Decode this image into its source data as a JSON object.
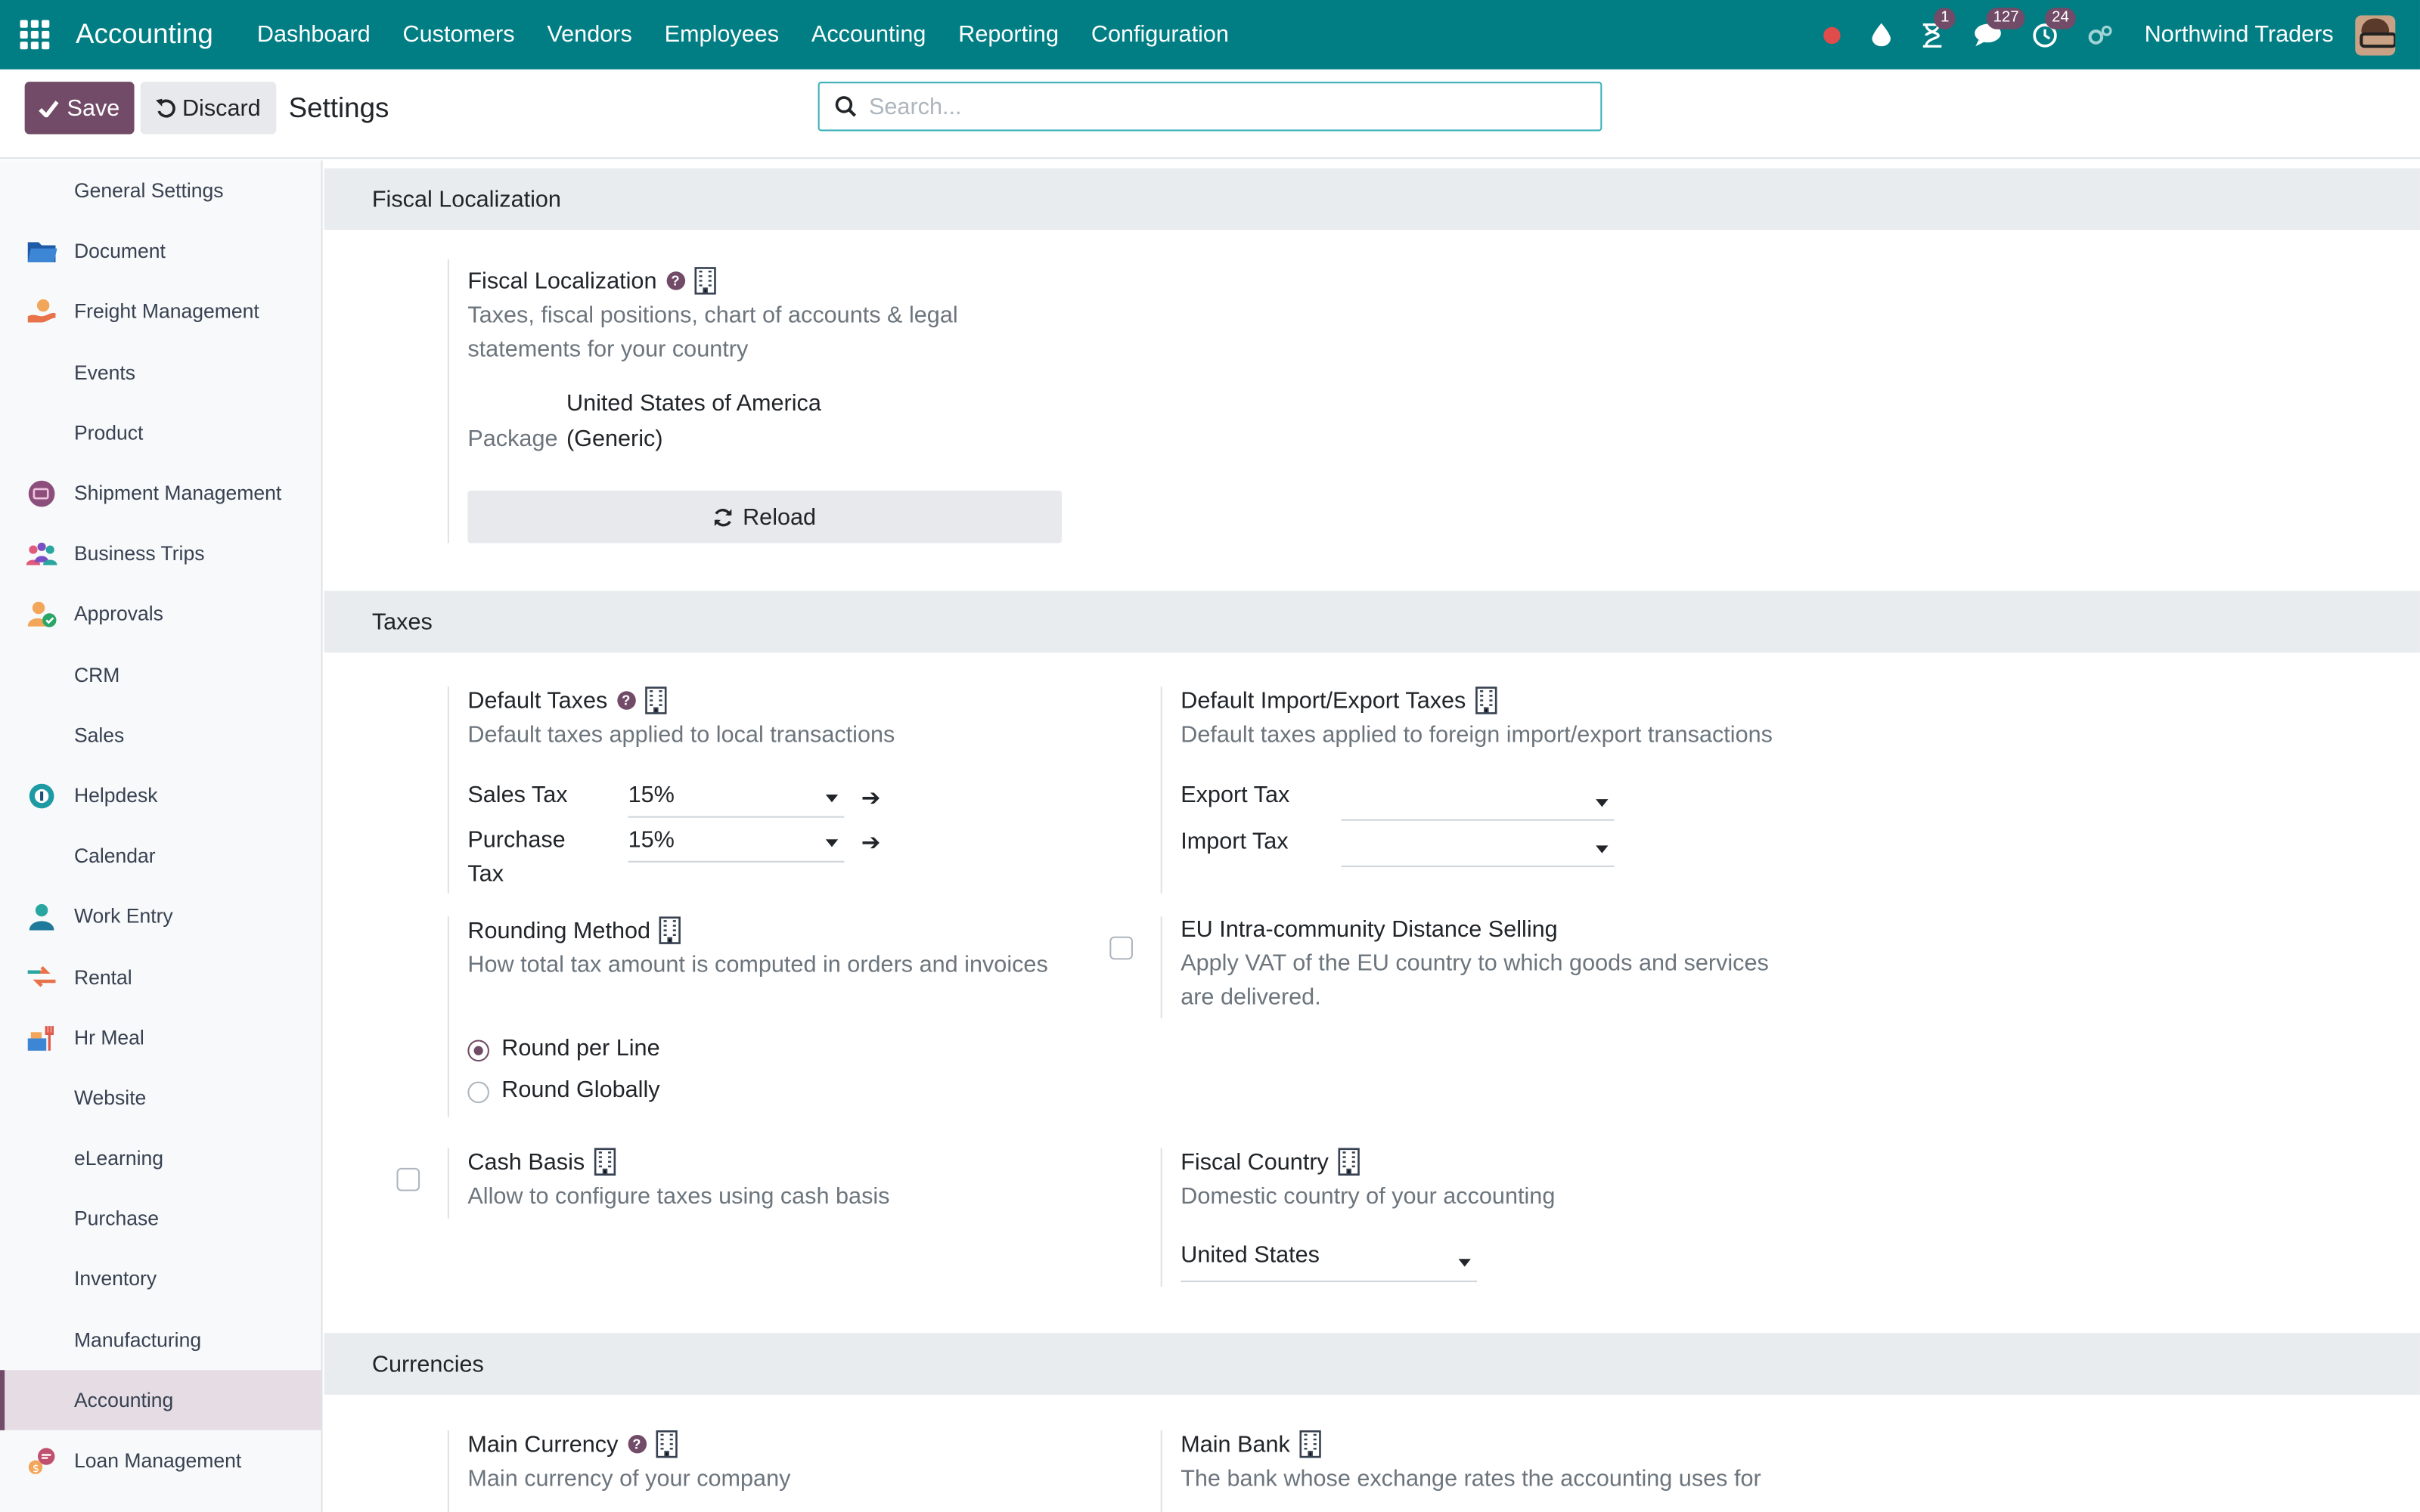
{
  "navbar": {
    "brand": "Accounting",
    "menu": [
      "Dashboard",
      "Customers",
      "Vendors",
      "Employees",
      "Accounting",
      "Reporting",
      "Configuration"
    ],
    "activity_badge": "1",
    "messages_badge": "127",
    "clock_badge": "24",
    "company": "Northwind Traders",
    "accent_color": "#017e84"
  },
  "control_panel": {
    "save_label": "Save",
    "discard_label": "Discard",
    "title": "Settings",
    "search_placeholder": "Search..."
  },
  "sidebar": {
    "items": [
      {
        "label": "General Settings",
        "icon": "none"
      },
      {
        "label": "Document",
        "icon": "folder-icon"
      },
      {
        "label": "Freight Management",
        "icon": "freight-icon"
      },
      {
        "label": "Events",
        "icon": "none"
      },
      {
        "label": "Product",
        "icon": "none"
      },
      {
        "label": "Shipment Management",
        "icon": "shipment-icon"
      },
      {
        "label": "Business Trips",
        "icon": "people-icon"
      },
      {
        "label": "Approvals",
        "icon": "approval-icon"
      },
      {
        "label": "CRM",
        "icon": "none"
      },
      {
        "label": "Sales",
        "icon": "none"
      },
      {
        "label": "Helpdesk",
        "icon": "helpdesk-icon"
      },
      {
        "label": "Calendar",
        "icon": "none"
      },
      {
        "label": "Work Entry",
        "icon": "person-icon"
      },
      {
        "label": "Rental",
        "icon": "rental-icon"
      },
      {
        "label": "Hr Meal",
        "icon": "meal-icon"
      },
      {
        "label": "Website",
        "icon": "none"
      },
      {
        "label": "eLearning",
        "icon": "none"
      },
      {
        "label": "Purchase",
        "icon": "none"
      },
      {
        "label": "Inventory",
        "icon": "none"
      },
      {
        "label": "Manufacturing",
        "icon": "none"
      },
      {
        "label": "Accounting",
        "icon": "none",
        "active": true
      },
      {
        "label": "Loan Management",
        "icon": "loan-icon"
      }
    ]
  },
  "fiscal": {
    "section_title": "Fiscal Localization",
    "title": "Fiscal Localization",
    "desc": "Taxes, fiscal positions, chart of accounts & legal statements for your country",
    "package_label": "Package",
    "package_value_line1": "United States of America",
    "package_value_line2": "(Generic)",
    "reload_label": "Reload"
  },
  "taxes": {
    "section_title": "Taxes",
    "default_taxes": {
      "title": "Default Taxes",
      "desc": "Default taxes applied to local transactions",
      "sales_label": "Sales Tax",
      "sales_value": "15%",
      "purchase_label_1": "Purchase",
      "purchase_label_2": "Tax",
      "purchase_value": "15%"
    },
    "import_export": {
      "title": "Default Import/Export Taxes",
      "desc": "Default taxes applied to foreign import/export transactions",
      "export_label": "Export Tax",
      "import_label": "Import Tax"
    },
    "rounding": {
      "title": "Rounding Method",
      "desc": "How total tax amount is computed in orders and invoices",
      "options": [
        "Round per Line",
        "Round Globally"
      ],
      "selected": "Round per Line"
    },
    "eu_distance": {
      "title": "EU Intra-community Distance Selling",
      "desc_line1": "Apply VAT of the EU country to which goods and services",
      "desc_line2": "are delivered.",
      "checked": false
    },
    "cash_basis": {
      "title": "Cash Basis",
      "desc": "Allow to configure taxes using cash basis",
      "checked": false
    },
    "fiscal_country": {
      "title": "Fiscal Country",
      "desc": "Domestic country of your accounting",
      "value": "United States"
    }
  },
  "currencies": {
    "section_title": "Currencies",
    "main_currency": {
      "title": "Main Currency",
      "desc": "Main currency of your company"
    },
    "main_bank": {
      "title": "Main Bank",
      "desc": "The bank whose exchange rates the accounting uses for"
    }
  }
}
